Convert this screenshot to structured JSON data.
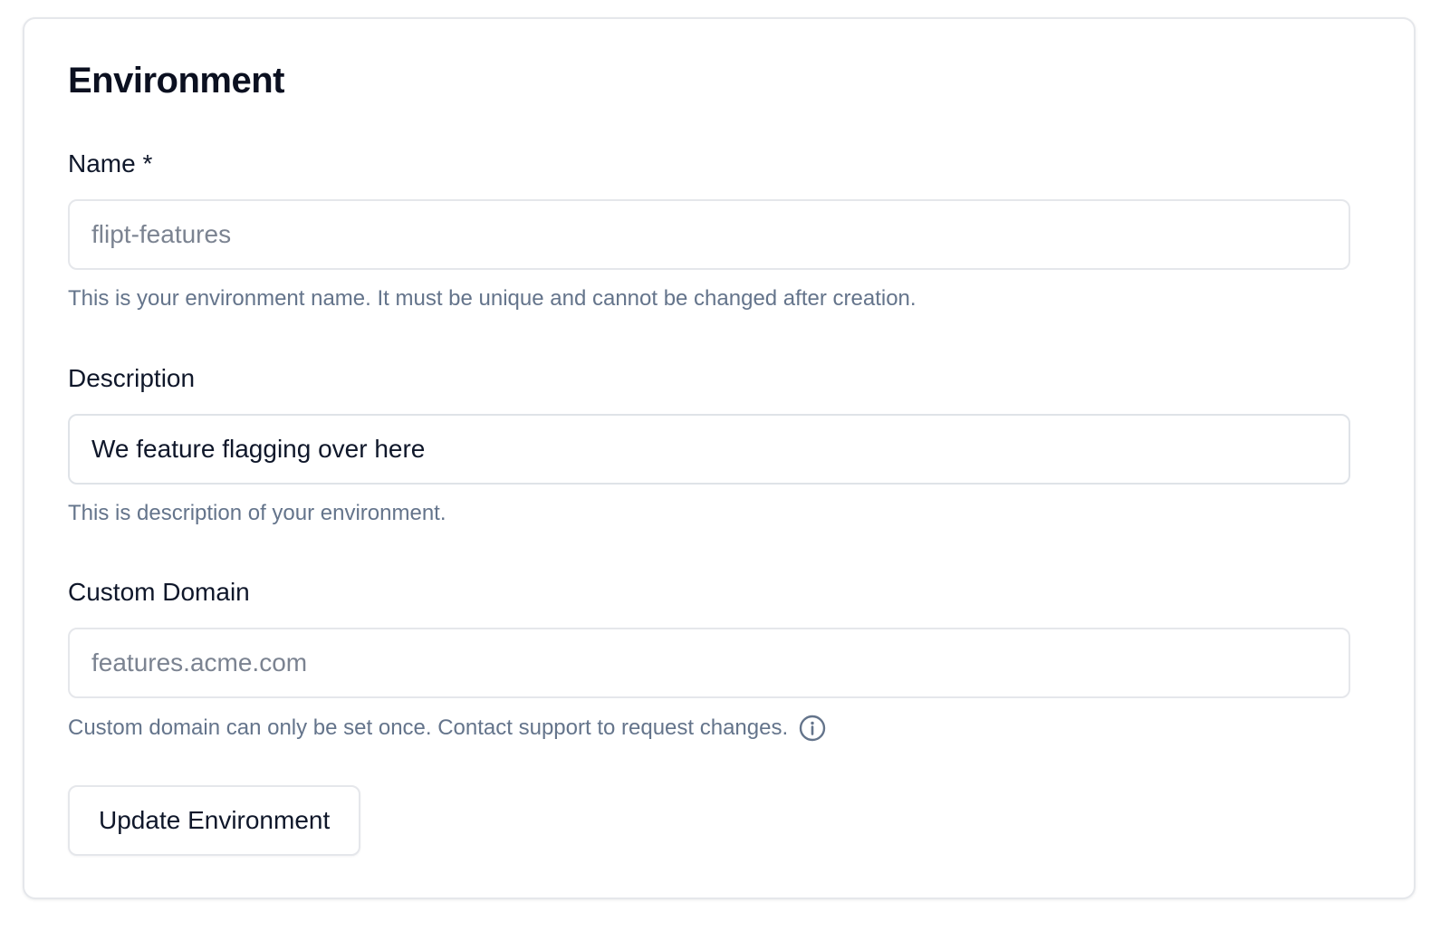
{
  "form": {
    "title": "Environment",
    "name": {
      "label": "Name *",
      "value": "",
      "placeholder": "flipt-features",
      "help": "This is your environment name. It must be unique and cannot be changed after creation."
    },
    "description": {
      "label": "Description",
      "value": "We feature flagging over here",
      "placeholder": "",
      "help": "This is description of your environment."
    },
    "custom_domain": {
      "label": "Custom Domain",
      "value": "",
      "placeholder": "features.acme.com",
      "help": "Custom domain can only be set once. Contact support to request changes.",
      "help_icon": "info-circle-icon"
    },
    "submit_label": "Update Environment"
  }
}
